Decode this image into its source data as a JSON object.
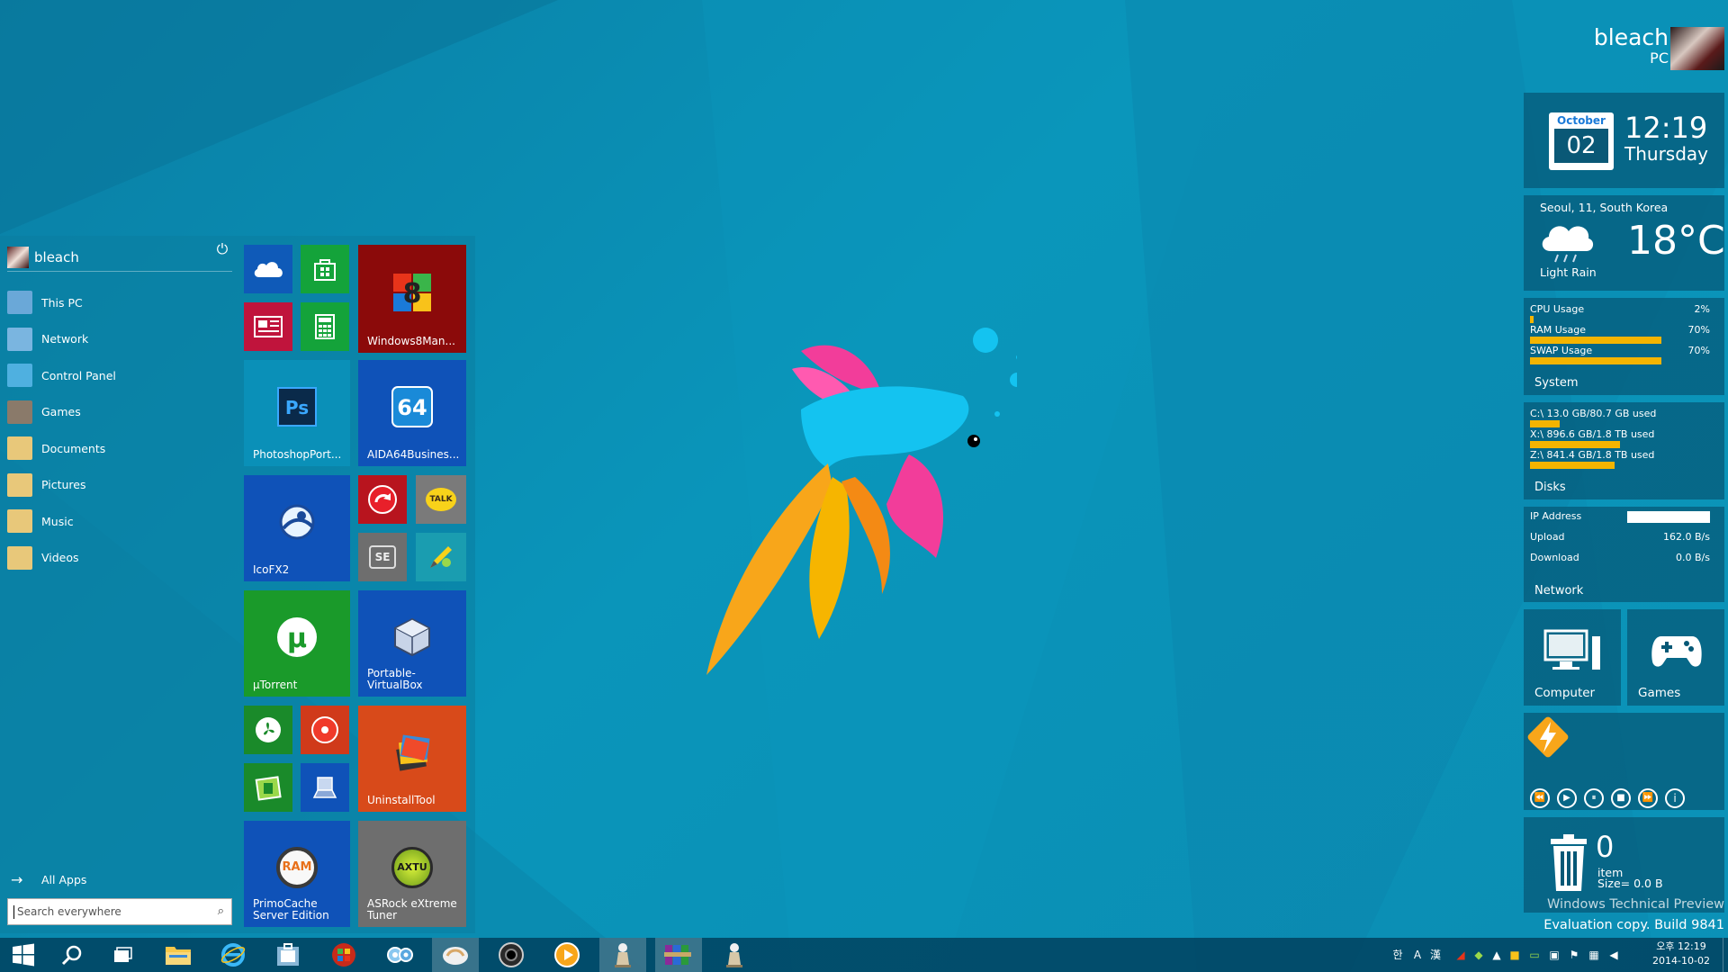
{
  "user": {
    "name": "bleach",
    "machine": "PC"
  },
  "start_menu": {
    "user_label": "bleach",
    "nav": [
      {
        "label": "This PC",
        "icon": "computer-icon",
        "color": "#6aa8d8"
      },
      {
        "label": "Network",
        "icon": "network-icon",
        "color": "#7ab5e0"
      },
      {
        "label": "Control Panel",
        "icon": "control-panel-icon",
        "color": "#4fb0e0"
      },
      {
        "label": "Games",
        "icon": "games-icon",
        "color": "#8a7a6a"
      },
      {
        "label": "Documents",
        "icon": "documents-folder-icon",
        "color": "#e8c87a"
      },
      {
        "label": "Pictures",
        "icon": "pictures-folder-icon",
        "color": "#e8c87a"
      },
      {
        "label": "Music",
        "icon": "music-folder-icon",
        "color": "#e8c87a"
      },
      {
        "label": "Videos",
        "icon": "videos-folder-icon",
        "color": "#e8c87a"
      }
    ],
    "all_apps": "All Apps",
    "search_placeholder": "Search everywhere"
  },
  "tiles": {
    "onedrive": {
      "color": "#0f5ab8"
    },
    "store": {
      "color": "#14a33a"
    },
    "news": {
      "color": "#c0143c"
    },
    "calculator": {
      "color": "#14a33a"
    },
    "windows8manager": {
      "label": "Windows8Man...",
      "color": "#8b0a0a"
    },
    "photoshop": {
      "label": "PhotoshopPort...",
      "color": "#0a90b8"
    },
    "aida64": {
      "label": "AIDA64Busines...",
      "color": "#0f52b8"
    },
    "icofx": {
      "label": "IcoFX2",
      "color": "#0f52b8"
    },
    "redapp": {
      "color": "#b8141e"
    },
    "talk": {
      "label": "TALK",
      "color": "#7a7a7a"
    },
    "se": {
      "label": "SE",
      "color": "#6e6e6e"
    },
    "pen": {
      "color": "#1a9db0"
    },
    "utorrent": {
      "label": "µTorrent",
      "color": "#1a9a2a"
    },
    "virtualbox": {
      "label": "Portable-\nVirtualBox",
      "color": "#0f52b8"
    },
    "greenapp": {
      "color": "#1a8a2a"
    },
    "redcircle": {
      "color": "#d03a1a"
    },
    "greensquare": {
      "color": "#1a8a2a"
    },
    "pcblue": {
      "color": "#0f52b8"
    },
    "uninstalltool": {
      "label": "UninstallTool",
      "color": "#d84a1a"
    },
    "primocache": {
      "label": "PrimoCache\nServer Edition",
      "color": "#0f52b8",
      "icon_text": "RAM"
    },
    "asrock": {
      "label": "ASRock eXtreme\nTuner",
      "color": "#6e6e6e",
      "icon_text": "AXTU"
    }
  },
  "clock": {
    "month": "October",
    "day": "02",
    "time": "12:19",
    "weekday": "Thursday"
  },
  "weather": {
    "location": "Seoul, 11, South Korea",
    "temp": "18°C",
    "condition": "Light Rain"
  },
  "system": {
    "title": "System",
    "rows": [
      {
        "label": "CPU Usage",
        "value": "2%",
        "pct": 2
      },
      {
        "label": "RAM Usage",
        "value": "70%",
        "pct": 70
      },
      {
        "label": "SWAP Usage",
        "value": "70%",
        "pct": 70
      }
    ]
  },
  "disks": {
    "title": "Disks",
    "rows": [
      {
        "label": "C:\\  13.0 GB/80.7 GB used",
        "pct": 16
      },
      {
        "label": "X:\\  896.6 GB/1.8 TB used",
        "pct": 48
      },
      {
        "label": "Z:\\  841.4 GB/1.8 TB used",
        "pct": 45
      }
    ]
  },
  "network": {
    "title": "Network",
    "ip_label": "IP Address",
    "upload_label": "Upload",
    "upload": "162.0 B/s",
    "download_label": "Download",
    "download": "0.0 B/s"
  },
  "shortcuts": {
    "computer": "Computer",
    "games": "Games"
  },
  "recycle": {
    "count": "0",
    "unit": "item",
    "size": "Size= 0.0 B"
  },
  "watermark": {
    "line1": "Windows Technical Preview",
    "line2": "Evaluation copy. Build 9841"
  },
  "taskbar": {
    "clock_time": "오후 12:19",
    "clock_date": "2014-10-02",
    "ime": [
      "한",
      "A",
      "漢"
    ]
  },
  "colors": {
    "accent": "#0a8fb5",
    "bar": "#f4b400",
    "widget_bg": "#065876"
  }
}
